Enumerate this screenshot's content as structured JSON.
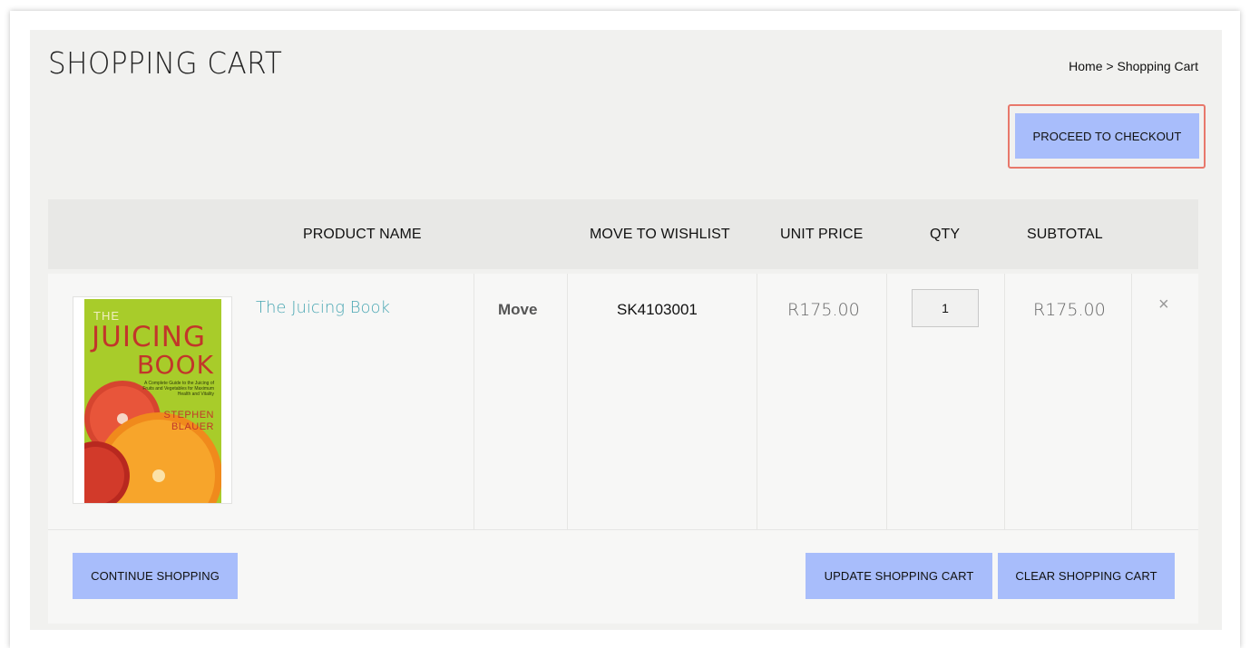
{
  "page": {
    "title": "SHOPPING CART"
  },
  "breadcrumb": {
    "home": "Home",
    "separator": " > ",
    "current": "Shopping Cart"
  },
  "buttons": {
    "checkout": "PROCEED TO CHECKOUT",
    "continue": "CONTINUE SHOPPING",
    "update": "UPDATE SHOPPING CART",
    "clear": "CLEAR SHOPPING CART"
  },
  "table": {
    "headers": {
      "product_name": "PRODUCT NAME",
      "move_to_wishlist": "MOVE TO WISHLIST",
      "unit_price": "UNIT PRICE",
      "qty": "QTY",
      "subtotal": "SUBTOTAL"
    },
    "items": [
      {
        "name": "The Juicing Book",
        "move_label": "Move",
        "sku": "SK4103001",
        "unit_price": "R175.00",
        "qty": "1",
        "subtotal": "R175.00",
        "remove_glyph": "×",
        "cover": {
          "the": "THE",
          "juicing": "JUICING",
          "book": "BOOK",
          "subtitle": "A Complete Guide to the Juicing of Fruits and Vegetables for Maximum Health and Vitality",
          "author_first": "STEPHEN",
          "author_last": "BLAUER"
        }
      }
    ]
  },
  "colors": {
    "button_bg": "#a8bdfb",
    "highlight_border": "#e8786b",
    "product_link": "#4aa7b3",
    "panel_bg": "#f1f1ef",
    "header_bg": "#e8e8e6"
  },
  "icons": {
    "remove": "close-icon"
  }
}
